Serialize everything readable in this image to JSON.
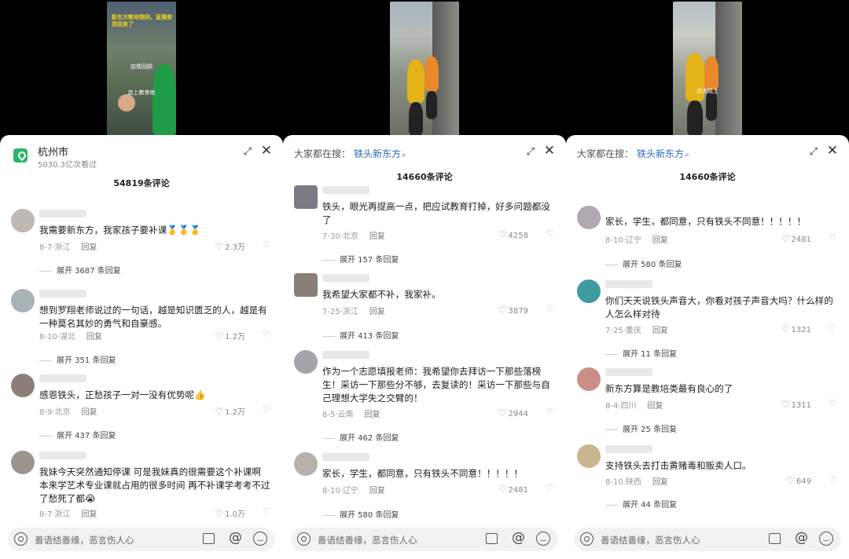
{
  "panels": [
    {
      "video": {
        "caption_top": "新东方教培倒闭，直播卖货回来了",
        "caption_mid": "前情回顾",
        "caption_low": "追上教育他"
      },
      "header": {
        "type": "location",
        "title": "杭州市",
        "views": "5030.3亿次看过"
      },
      "comment_count": "54819条评论",
      "comments": [
        {
          "text": "我需要新东方，我家孩子要补课🥇🥇🥇",
          "date": "8-7",
          "region": "浙江",
          "reply": "回复",
          "likes": "2.3万",
          "more": "展开 3687 条回复"
        },
        {
          "text": "想到罗翔老师说过的一句话，越是知识匮乏的人，越是有一种莫名其妙的勇气和自豪感。",
          "date": "8-10",
          "region": "湖北",
          "reply": "回复",
          "likes": "1.2万",
          "more": "展开 351 条回复"
        },
        {
          "text": "感恩铁头，正愁孩子一对一没有优势呢👍",
          "date": "8-9",
          "region": "北京",
          "reply": "回复",
          "likes": "1.2万",
          "more": "展开 437 条回复"
        },
        {
          "text": "我妹今天突然通知停课 可是我妹真的很需要这个补课啊 本来学艺术专业课就占用的很多时间 再不补课学考考不过了愁死了都😭",
          "date": "8-7",
          "region": "浙江",
          "reply": "回复",
          "likes": "1.0万",
          "more": ""
        }
      ],
      "input_placeholder": "善语结善缘，恶言伤人心"
    },
    {
      "video": {
        "caption_top": "",
        "caption_mid": "",
        "caption_low": ""
      },
      "header": {
        "type": "search",
        "label": "大家都在搜：",
        "hot": "铁头新东方"
      },
      "comment_count": "14660条评论",
      "comments": [
        {
          "text": "铁头，眼光再提高一点，把应试教育打掉，好多问题都没了",
          "date": "7-30",
          "region": "北京",
          "reply": "回复",
          "likes": "4258",
          "more": "展开 157 条回复"
        },
        {
          "text": "我希望大家都不补，我家补。",
          "date": "7-25",
          "region": "浙江",
          "reply": "回复",
          "likes": "3879",
          "more": "展开 413 条回复"
        },
        {
          "text": "作为一个志愿填报老师：我希望你去拜访一下那些落榜生！采访一下那些分不够，去复读的！采访一下那些与自己理想大学失之交臂的！",
          "date": "8-5",
          "region": "云南",
          "reply": "回复",
          "likes": "2944",
          "more": "展开 462 条回复"
        },
        {
          "text": "家长，学生，都同意，只有铁头不同意！！！！！",
          "date": "8-10",
          "region": "辽宁",
          "reply": "回复",
          "likes": "2481",
          "more": "展开 580 条回复"
        }
      ],
      "input_placeholder": "善语结善缘，恶言伤人心"
    },
    {
      "video": {
        "caption_top": "",
        "caption_mid": "没太踏上",
        "caption_low": ""
      },
      "header": {
        "type": "search",
        "label": "大家都在搜：",
        "hot": "铁头新东方"
      },
      "comment_count": "14660条评论",
      "comments": [
        {
          "text": "家长，学生，都同意，只有铁头不同意！！！！！",
          "date": "8-10",
          "region": "辽宁",
          "reply": "回复",
          "likes": "2481",
          "more": "展开 580 条回复"
        },
        {
          "text": "你们天天说铁头声音大，你看对孩子声音大吗？什么样的人怎么样对待",
          "date": "7-25",
          "region": "重庆",
          "reply": "回复",
          "likes": "1321",
          "more": "展开 11 条回复"
        },
        {
          "text": "新东方算是教培类最有良心的了",
          "date": "8-4",
          "region": "四川",
          "reply": "回复",
          "likes": "1311",
          "more": "展开 25 条回复"
        },
        {
          "text": "支持铁头去打击黄赌毒和贩卖人口。",
          "date": "8-10",
          "region": "陕西",
          "reply": "回复",
          "likes": "649",
          "more": "展开 44 条回复"
        }
      ],
      "input_placeholder": "善语结善缘，恶言伤人心"
    }
  ]
}
